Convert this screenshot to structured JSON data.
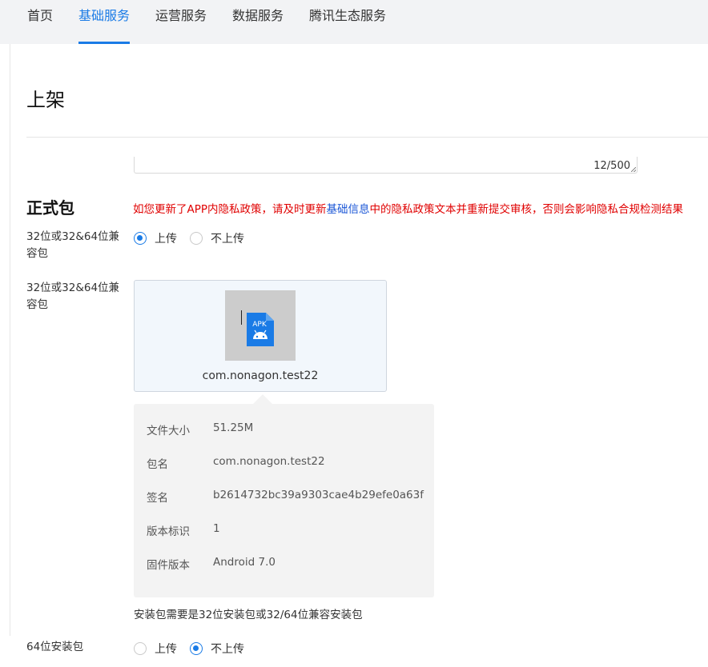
{
  "nav": {
    "items": [
      {
        "label": "首页"
      },
      {
        "label": "基础服务"
      },
      {
        "label": "运营服务"
      },
      {
        "label": "数据服务"
      },
      {
        "label": "腾讯生态服务"
      }
    ],
    "active": "基础服务"
  },
  "page": {
    "title": "上架",
    "char_counter": "12/500"
  },
  "section": {
    "title": "正式包",
    "warning_prefix": "如您更新了APP内隐私政策，请及时更新",
    "warning_link": "基础信息",
    "warning_suffix": "中的隐私政策文本并重新提交审核，否则会影响隐私合规检测结果"
  },
  "compat_upload": {
    "label": "32位或32&64位兼容包",
    "options": [
      "上传",
      "不上传"
    ],
    "selected": "上传"
  },
  "compat_package": {
    "label": "32位或32&64位兼容包",
    "icon": "apk-file-icon",
    "icon_text": "APK",
    "filename": "com.nonagon.test22"
  },
  "package_info": {
    "rows": [
      {
        "key": "文件大小",
        "value": "51.25M"
      },
      {
        "key": "包名",
        "value": "com.nonagon.test22"
      },
      {
        "key": "签名",
        "value": "b2614732bc39a9303cae4b29efe0a63f"
      },
      {
        "key": "版本标识",
        "value": "1"
      },
      {
        "key": "固件版本",
        "value": "Android 7.0"
      }
    ]
  },
  "hint": "安装包需要是32位安装包或32/64位兼容安装包",
  "pkg64": {
    "label": "64位安装包",
    "options": [
      "上传",
      "不上传"
    ],
    "selected": "不上传"
  },
  "colors": {
    "accent": "#1a7be6",
    "warning": "#e00000",
    "link": "#1a56d6"
  }
}
